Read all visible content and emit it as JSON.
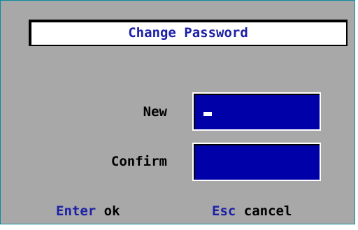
{
  "dialog": {
    "title": "Change Password",
    "fields": {
      "new_label": "New",
      "new_value": "",
      "confirm_label": "Confirm",
      "confirm_value": ""
    },
    "hints": {
      "ok_key": "Enter",
      "ok_action": "ok",
      "cancel_key": "Esc",
      "cancel_action": "cancel"
    },
    "colors": {
      "background": "#a8a8a8",
      "field": "#0000a8",
      "accent_text": "#1b1fa6",
      "border": "#0a8c9c"
    }
  }
}
